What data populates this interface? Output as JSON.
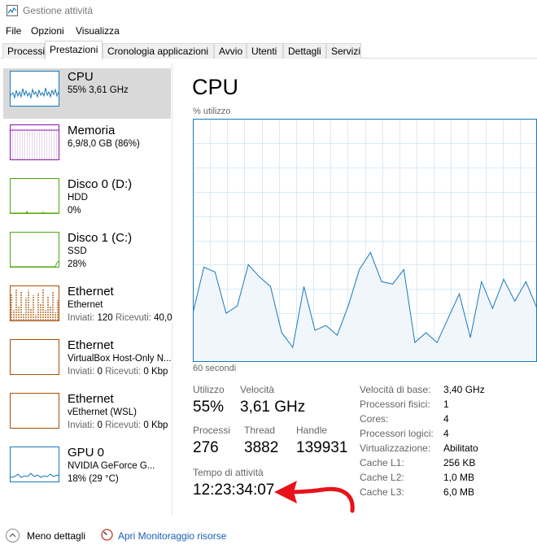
{
  "window": {
    "title": "Gestione attività"
  },
  "menu": [
    "File",
    "Opzioni",
    "Visualizza"
  ],
  "tabs": [
    "Processi",
    "Prestazioni",
    "Cronologia applicazioni",
    "Avvio",
    "Utenti",
    "Dettagli",
    "Servizi"
  ],
  "active_tab": "Prestazioni",
  "sidebar": [
    {
      "title": "CPU",
      "line1": "55% 3,61 GHz",
      "line2": "",
      "color": "#1779ba"
    },
    {
      "title": "Memoria",
      "line1": "6,9/8,0 GB (86%)",
      "line2": "",
      "color": "#8b12ae"
    },
    {
      "title": "Disco 0 (D:)",
      "line1": "HDD",
      "line2": "0%",
      "color": "#4da60c"
    },
    {
      "title": "Disco 1 (C:)",
      "line1": "SSD",
      "line2": "28%",
      "color": "#4da60c"
    },
    {
      "title": "Ethernet",
      "line1": "Ethernet",
      "line2_label1": "Inviati:",
      "line2_val1": "120",
      "line2_label2": "Ricevuti:",
      "line2_val2": "40,0",
      "color": "#a74f01"
    },
    {
      "title": "Ethernet",
      "line1": "VirtualBox Host-Only N...",
      "line2_label1": "Inviati:",
      "line2_val1": "0",
      "line2_label2": "Ricevuti:",
      "line2_val2": "0 Kbp",
      "color": "#a74f01"
    },
    {
      "title": "Ethernet",
      "line1": "vEthernet (WSL)",
      "line2_label1": "Inviati:",
      "line2_val1": "0",
      "line2_label2": "Ricevuti:",
      "line2_val2": "0 Kbp",
      "color": "#a74f01"
    },
    {
      "title": "GPU 0",
      "line1": "NVIDIA GeForce G...",
      "line2": "18% (29 °C)",
      "color": "#1779ba"
    }
  ],
  "main": {
    "title": "CPU",
    "graph_label": "% utilizzo",
    "time_label": "60 secondi",
    "graph_color": "#1779ba",
    "cpu_history": [
      20,
      39,
      37,
      20,
      23,
      40,
      35,
      31,
      12,
      6,
      31,
      13,
      15,
      11,
      23,
      38,
      45,
      33,
      32,
      38,
      8,
      12,
      8,
      18,
      28,
      10,
      33,
      22,
      34,
      25,
      33,
      22
    ]
  },
  "stats": {
    "utilizzo_label": "Utilizzo",
    "utilizzo_value": "55%",
    "velocita_label": "Velocità",
    "velocita_value": "3,61 GHz",
    "processi_label": "Processi",
    "processi_value": "276",
    "thread_label": "Thread",
    "thread_value": "3882",
    "handle_label": "Handle",
    "handle_value": "139931",
    "uptime_label": "Tempo di attività",
    "uptime_value": "12:23:34:07"
  },
  "specs": [
    {
      "label": "Velocità di base:",
      "value": "3,40 GHz"
    },
    {
      "label": "Processori fisici:",
      "value": "1"
    },
    {
      "label": "Cores:",
      "value": "4"
    },
    {
      "label": "Processori logici:",
      "value": "4"
    },
    {
      "label": "Virtualizzazione:",
      "value": "Abilitato"
    },
    {
      "label": "Cache L1:",
      "value": "256 KB"
    },
    {
      "label": "Cache L2:",
      "value": "1,0 MB"
    },
    {
      "label": "Cache L3:",
      "value": "6,0 MB"
    }
  ],
  "footer": {
    "less_details": "Meno dettagli",
    "monitor_link": "Apri Monitoraggio risorse"
  },
  "annotation": {
    "arrow_color": "#e8121a"
  }
}
